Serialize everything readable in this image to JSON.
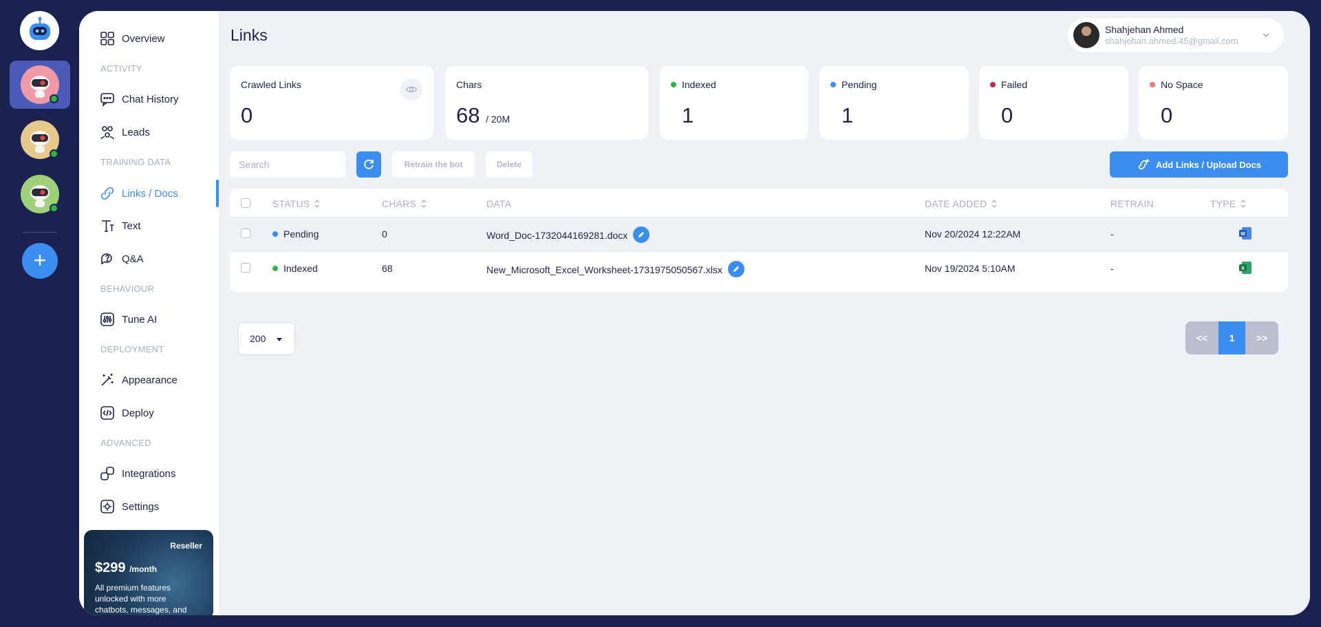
{
  "page": {
    "title": "Links"
  },
  "user": {
    "name": "Shahjehan Ahmed",
    "email": "shahjehan.ahmed.45@gmail.com"
  },
  "sidebar": {
    "overview": "Overview",
    "sections": {
      "activity": "ACTIVITY",
      "training": "TRAINING DATA",
      "behaviour": "BEHAVIOUR",
      "deployment": "DEPLOYMENT",
      "advanced": "ADVANCED"
    },
    "items": {
      "chat_history": "Chat History",
      "leads": "Leads",
      "links_docs": "Links / Docs",
      "text": "Text",
      "qa": "Q&A",
      "tune_ai": "Tune AI",
      "appearance": "Appearance",
      "deploy": "Deploy",
      "integrations": "Integrations",
      "settings": "Settings"
    },
    "promo": {
      "tag": "Reseller",
      "price": "$299",
      "period": "/month",
      "description": "All premium features unlocked with more chatbots, messages, and"
    }
  },
  "stats": {
    "crawled": {
      "label": "Crawled Links",
      "value": "0"
    },
    "chars": {
      "label": "Chars",
      "value": "68",
      "suffix": "/ 20M"
    },
    "indexed": {
      "label": "Indexed",
      "value": "1",
      "color": "#2fb344"
    },
    "pending": {
      "label": "Pending",
      "value": "1",
      "color": "#3c8df0"
    },
    "failed": {
      "label": "Failed",
      "value": "0",
      "color": "#c8284f"
    },
    "nospace": {
      "label": "No Space",
      "value": "0",
      "color": "#f07b6c"
    }
  },
  "toolbar": {
    "search_placeholder": "Search",
    "retrain": "Retrain the bot",
    "delete": "Delete",
    "add": "Add Links / Upload Docs"
  },
  "table": {
    "headers": {
      "status": "STATUS",
      "chars": "CHARS",
      "data": "DATA",
      "date_added": "DATE ADDED",
      "retrain": "RETRAIN",
      "type": "TYPE"
    },
    "rows": [
      {
        "status": "Pending",
        "status_color": "#3c8df0",
        "chars": "0",
        "data": "Word_Doc-1732044169281.docx",
        "date": "Nov 20/2024 12:22AM",
        "retrain": "-",
        "type": "word-icon"
      },
      {
        "status": "Indexed",
        "status_color": "#2fb344",
        "chars": "68",
        "data": "New_Microsoft_Excel_Worksheet-1731975050567.xlsx",
        "date": "Nov 19/2024 5:10AM",
        "retrain": "-",
        "type": "excel-icon"
      }
    ]
  },
  "pagination": {
    "page_size": "200",
    "prev": "<<",
    "current": "1",
    "next": ">>"
  }
}
